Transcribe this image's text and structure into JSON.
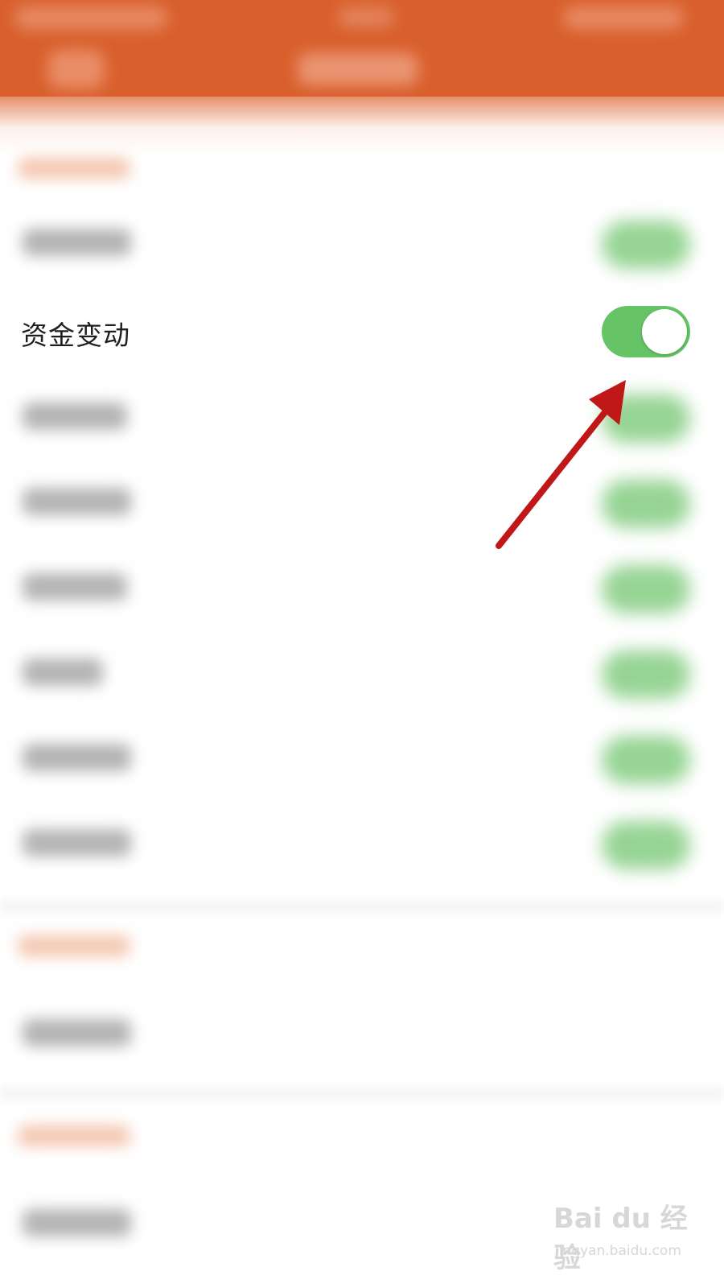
{
  "colors": {
    "header_bg": "#d9602d",
    "toggle_on": "#66c466",
    "arrow": "#c01818",
    "text": "#1e1e1e"
  },
  "settings": {
    "highlighted_item": {
      "label": "资金变动",
      "toggle_state": "on"
    }
  },
  "watermark": {
    "logo": "Bai du 经验",
    "url": "jingyan.baidu.com"
  }
}
